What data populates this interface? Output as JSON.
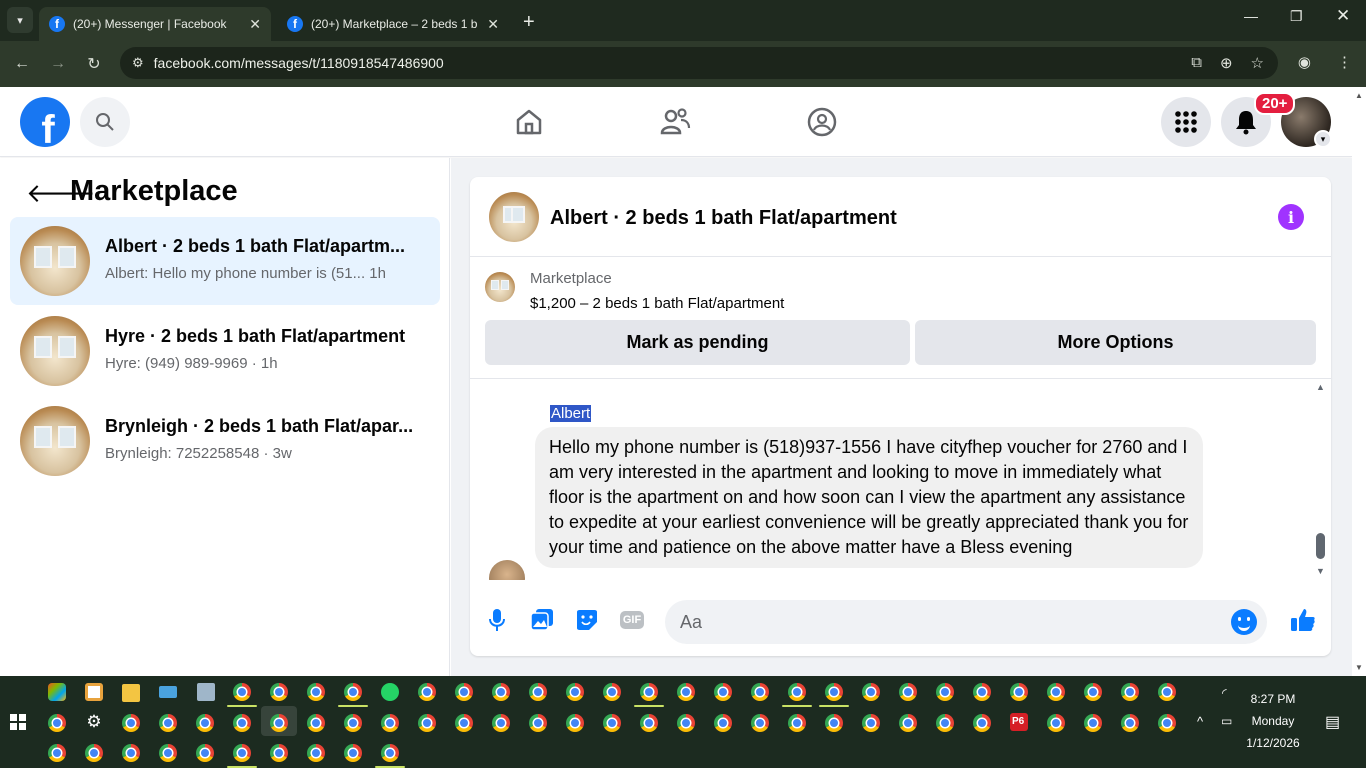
{
  "browser": {
    "tabs": [
      {
        "title": "(20+) Messenger | Facebook",
        "active": true
      },
      {
        "title": "(20+) Marketplace – 2 beds 1 b",
        "active": false
      }
    ],
    "url": "facebook.com/messages/t/1180918547486900"
  },
  "fb_header": {
    "logo": "f",
    "notification_badge": "20+"
  },
  "marketplace": {
    "title": "Marketplace",
    "conversations": [
      {
        "name": "Albert · 2 beds 1 bath Flat/apartm...",
        "preview": "Albert: Hello my phone number is (51...  1h",
        "selected": true
      },
      {
        "name": "Hyre · 2 beds 1 bath Flat/apartment",
        "preview": "Hyre: (949) 989-9969 · 1h",
        "selected": false
      },
      {
        "name": "Brynleigh · 2 beds 1 bath Flat/apar...",
        "preview": "Brynleigh: 7252258548 · 3w",
        "selected": false
      }
    ]
  },
  "chat": {
    "title": "Albert · 2 beds 1 bath Flat/apartment",
    "listing_label": "Marketplace",
    "listing_price": "$1,200 – 2 beds 1 bath Flat/apartment",
    "buttons": {
      "pending": "Mark as pending",
      "more": "More Options"
    },
    "sender": "Albert",
    "message": "Hello my phone number is (518)937-1556 I have cityfhep voucher for 2760 and I am very interested in the apartment and looking to move in immediately what floor is the apartment on and how soon can I view the apartment any assistance to expedite at your earliest convenience will be greatly appreciated thank you for your time and patience on the above matter have a Bless evening",
    "composer_placeholder": "Aa",
    "gif_label": "GIF"
  },
  "taskbar": {
    "time": "8:27 PM",
    "day": "Monday",
    "date": "1/12/2026",
    "p6_label": "P6"
  },
  "colors": {
    "fb_blue": "#1877f2",
    "messenger_blue": "#0a7cff",
    "selected_bg": "#e7f3ff",
    "info_purple": "#a033ff",
    "badge_red": "#e41e3f"
  }
}
